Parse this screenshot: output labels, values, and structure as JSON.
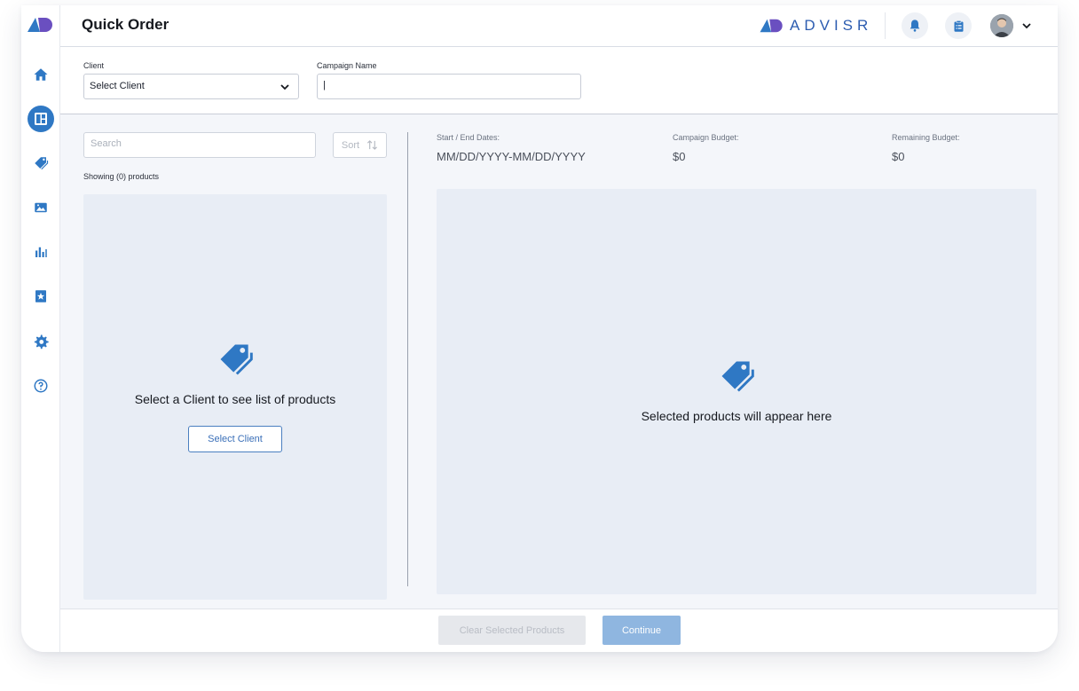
{
  "app": {
    "page_title": "Quick Order",
    "brand": "ADVISR"
  },
  "colors": {
    "accent": "#2f78c4",
    "brand": "#2c5cb0",
    "panel_bg": "#e8edf5",
    "continue_bg": "#8fb6e0"
  },
  "sidebar": {
    "items": [
      {
        "name": "home",
        "icon": "home-icon",
        "active": false
      },
      {
        "name": "dashboard",
        "icon": "dashboard-icon",
        "active": true
      },
      {
        "name": "products",
        "icon": "tag-icon",
        "active": false
      },
      {
        "name": "media",
        "icon": "image-icon",
        "active": false
      },
      {
        "name": "reports",
        "icon": "bar-chart-icon",
        "active": false
      },
      {
        "name": "favorites",
        "icon": "bookmark-star-icon",
        "active": false
      },
      {
        "name": "settings",
        "icon": "gear-icon",
        "active": false
      },
      {
        "name": "help",
        "icon": "help-icon",
        "active": false
      }
    ]
  },
  "header_icons": [
    "bell-icon",
    "clipboard-icon",
    "avatar",
    "chevron-down-icon"
  ],
  "form": {
    "client_label": "Client",
    "client_value": "Select Client",
    "campaign_label": "Campaign Name",
    "campaign_value": "|"
  },
  "products": {
    "search_placeholder": "Search",
    "sort_label": "Sort",
    "showing": "Showing (0) products",
    "empty_message": "Select a Client to see list of products",
    "select_client_button": "Select Client"
  },
  "summary": {
    "dates_label": "Start / End Dates:",
    "dates_value": "MM/DD/YYYY-MM/DD/YYYY",
    "campaign_budget_label": "Campaign Budget:",
    "campaign_budget_value": "$0",
    "remaining_budget_label": "Remaining Budget:",
    "remaining_budget_value": "$0"
  },
  "selected": {
    "empty_message": "Selected products will appear here"
  },
  "footer": {
    "clear_label": "Clear Selected Products",
    "continue_label": "Continue"
  }
}
